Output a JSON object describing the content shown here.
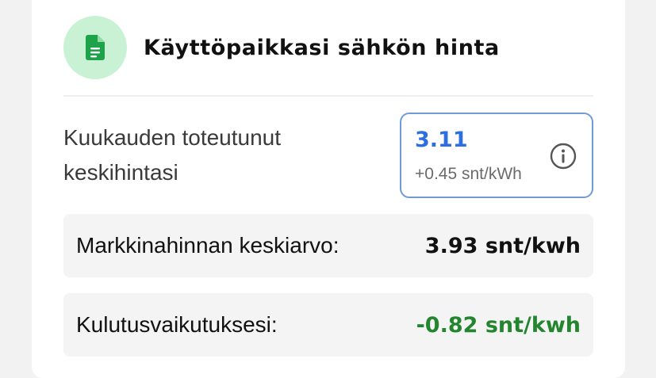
{
  "header": {
    "icon": "document-icon",
    "title": "Käyttöpaikkasi sähkön hinta"
  },
  "monthly_price": {
    "label": "Kuukauden toteutunut keskihintasi",
    "value": "3.11",
    "delta": "+0.45 snt/kWh",
    "info_icon": "info-icon"
  },
  "rows": [
    {
      "label": "Markkinahinnan keskiarvo:",
      "value": "3.93 snt/kwh"
    },
    {
      "label": "Kulutusvaikutuksesi:",
      "value": "-0.82 snt/kwh"
    }
  ],
  "colors": {
    "accent_blue": "#2d6fe0",
    "positive_green": "#23862f",
    "icon_bg": "#c9f2d4",
    "icon_fg": "#1fa34a",
    "box_border": "#6f9bd9"
  }
}
